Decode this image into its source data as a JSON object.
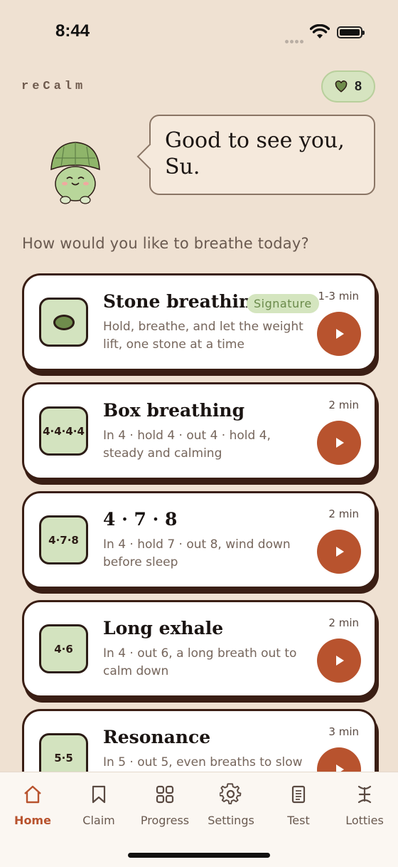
{
  "status": {
    "time": "8:44"
  },
  "header": {
    "brand": "reCalm",
    "hearts_count": "8"
  },
  "greeting": {
    "text": "Good to see you, Su."
  },
  "prompt": "How would you like to breathe today?",
  "exercises": [
    {
      "title": "Stone breathing",
      "badge": "Signature",
      "icon_label": "",
      "icon": "stone-icon",
      "description": "Hold, breathe, and let the weight lift, one stone at a time",
      "duration": "1-3 min"
    },
    {
      "title": "Box breathing",
      "badge": "",
      "icon_label": "4·4·4·4",
      "description": "In 4 · hold 4 · out 4 · hold 4, steady and calming",
      "duration": "2 min"
    },
    {
      "title": "4 · 7 · 8",
      "badge": "",
      "icon_label": "4·7·8",
      "description": "In 4 · hold 7 · out 8, wind down before sleep",
      "duration": "2 min"
    },
    {
      "title": "Long exhale",
      "badge": "",
      "icon_label": "4·6",
      "description": "In 4 · out 6, a long breath out to calm down",
      "duration": "2 min"
    },
    {
      "title": "Resonance",
      "badge": "",
      "icon_label": "5·5",
      "description": "In 5 · out 5, even breaths to slow",
      "duration": "3 min"
    }
  ],
  "tabs": [
    {
      "label": "Home",
      "icon": "home-icon",
      "active": true
    },
    {
      "label": "Claim",
      "icon": "bookmark-icon",
      "active": false
    },
    {
      "label": "Progress",
      "icon": "grid-icon",
      "active": false
    },
    {
      "label": "Settings",
      "icon": "gear-icon",
      "active": false
    },
    {
      "label": "Test",
      "icon": "document-icon",
      "active": false
    },
    {
      "label": "Lotties",
      "icon": "lotties-icon",
      "active": false
    }
  ],
  "colors": {
    "accent": "#b8532e",
    "background": "#efe1d2",
    "card_border": "#3a1e14",
    "green": "#d3e3bf"
  }
}
